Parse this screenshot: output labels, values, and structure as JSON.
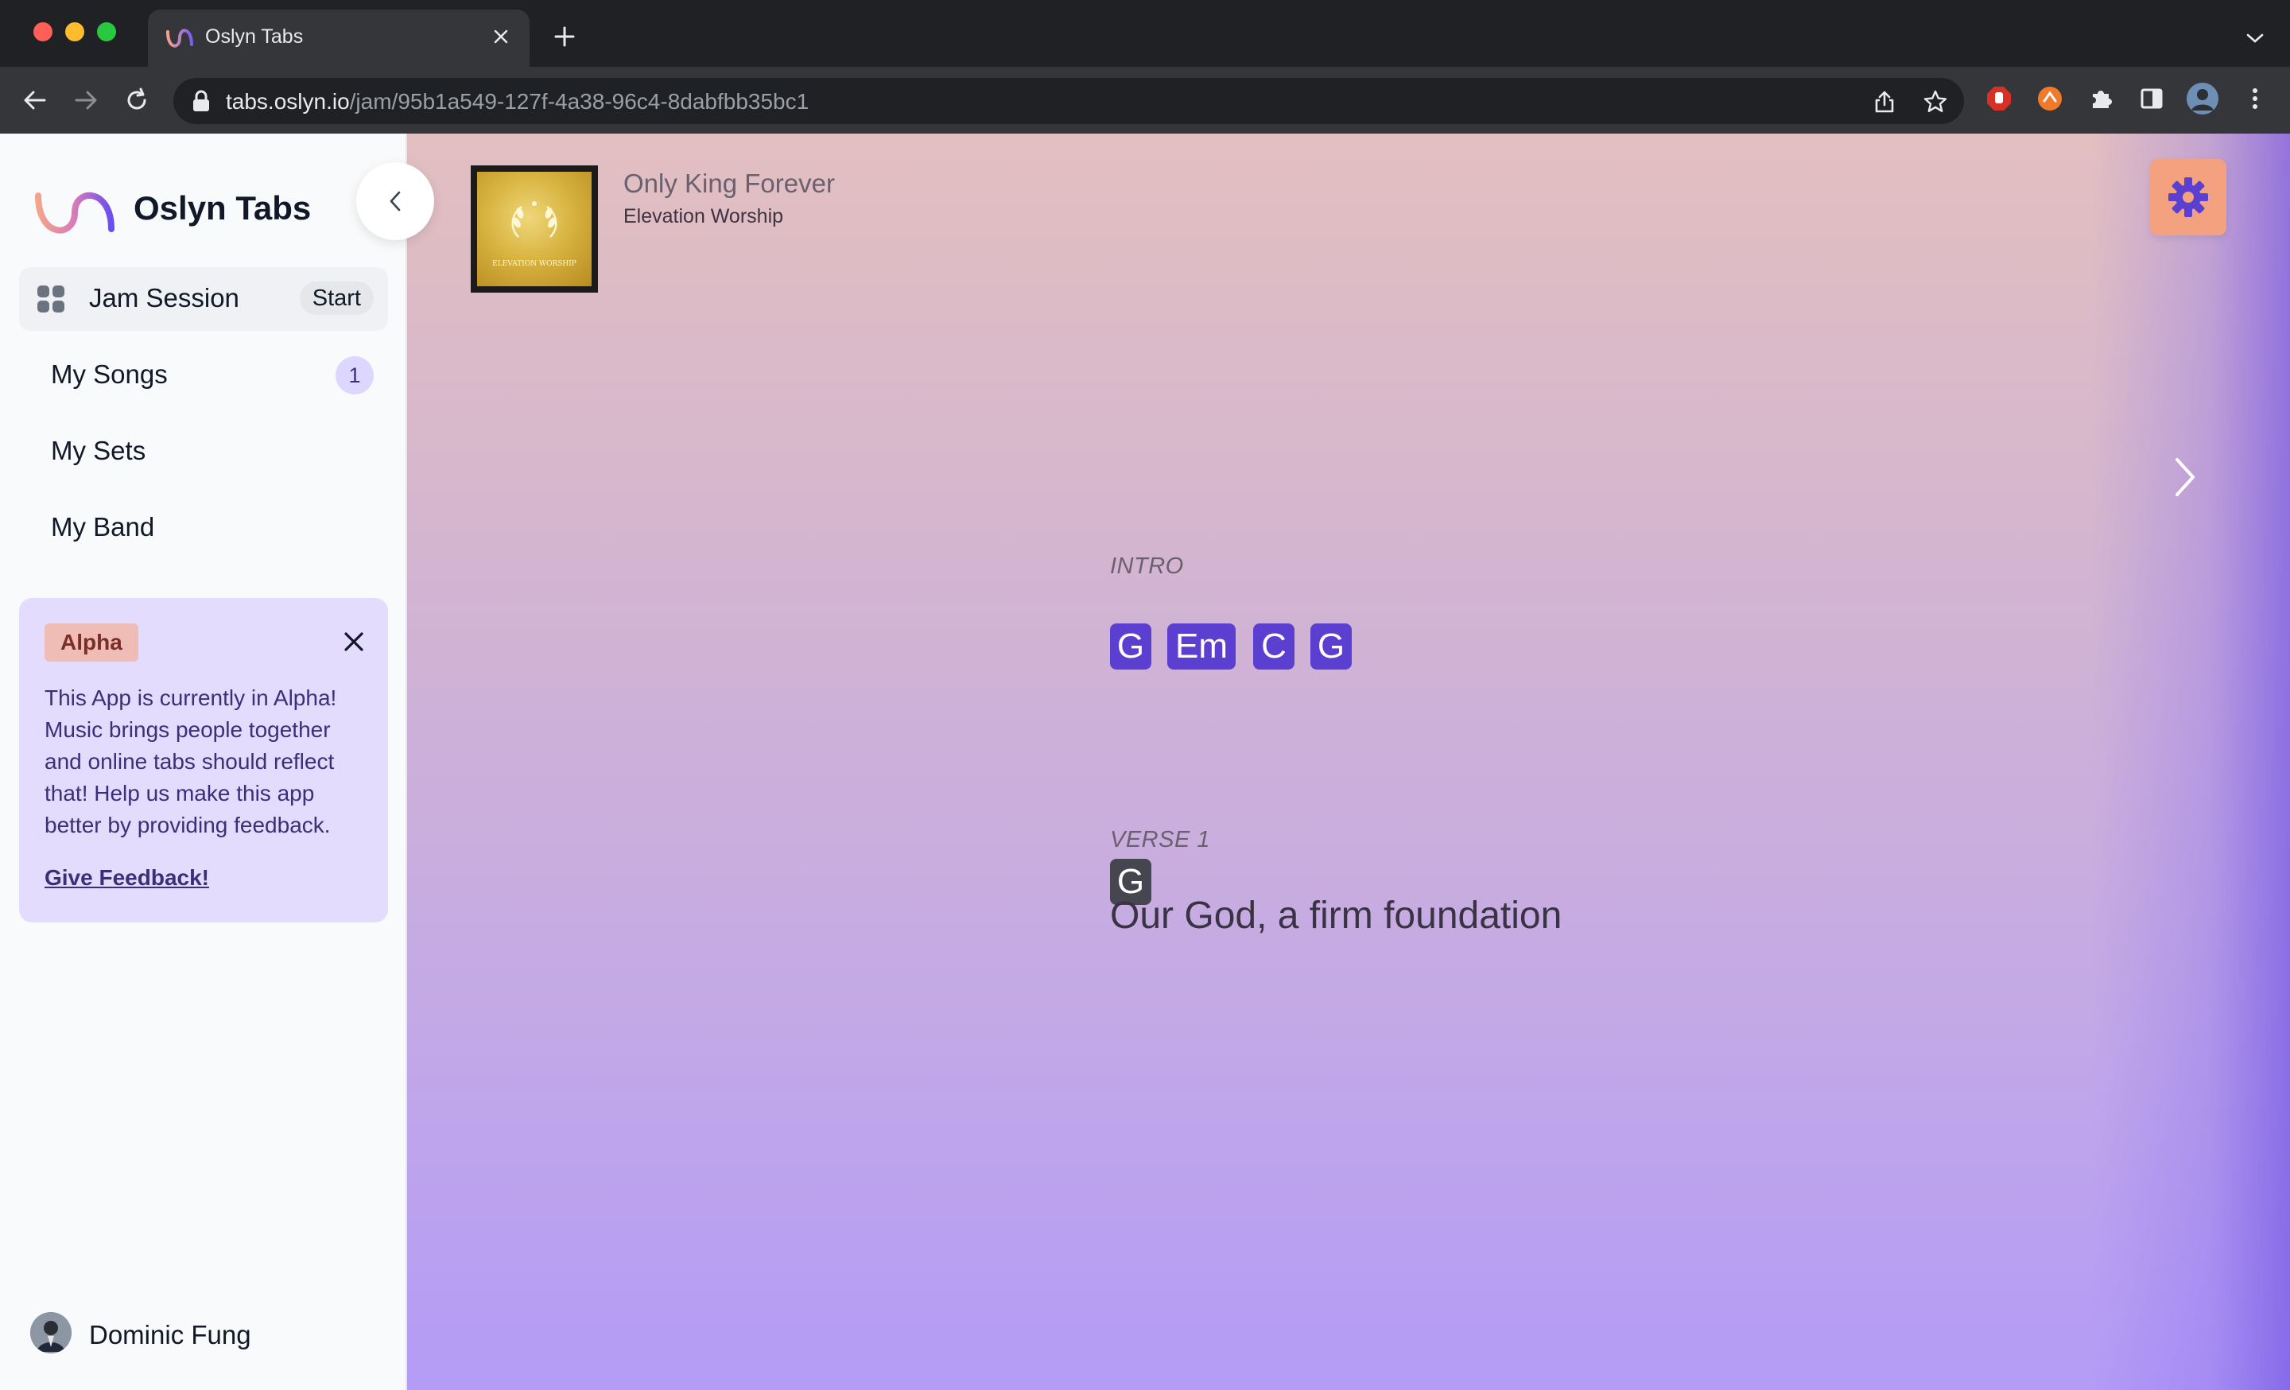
{
  "browser": {
    "tab_title": "Oslyn Tabs",
    "url_host": "tabs.oslyn.io",
    "url_path": "/jam/95b1a549-127f-4a38-96c4-8dabfbb35bc1"
  },
  "sidebar": {
    "brand": "Oslyn Tabs",
    "items": [
      {
        "label": "Jam Session",
        "pill": "Start",
        "icon": "grid-icon"
      },
      {
        "label": "My Songs",
        "count": "1"
      },
      {
        "label": "My Sets"
      },
      {
        "label": "My Band"
      }
    ],
    "alpha": {
      "badge": "Alpha",
      "text": "This App is currently in Alpha! Music brings people together and online tabs should reflect that! Help us make this app better by providing feedback.",
      "link": "Give Feedback!"
    },
    "user": {
      "name": "Dominic Fung"
    }
  },
  "song": {
    "title": "Only King Forever",
    "artist": "Elevation Worship",
    "album_art_text": "ELEVATION WORSHIP"
  },
  "sections": [
    {
      "label": "INTRO",
      "chords": [
        "G",
        "Em",
        "C",
        "G"
      ]
    },
    {
      "label": "VERSE 1",
      "chord": "G",
      "lyric": "Our God, a firm foundation"
    }
  ],
  "colors": {
    "chord_bg": "#5b3fd0",
    "active_chord_bg": "#454650",
    "settings_bg": "#f3a17e",
    "alpha_card_bg": "#e4dcfd",
    "alpha_badge_bg": "#efbcb6"
  }
}
